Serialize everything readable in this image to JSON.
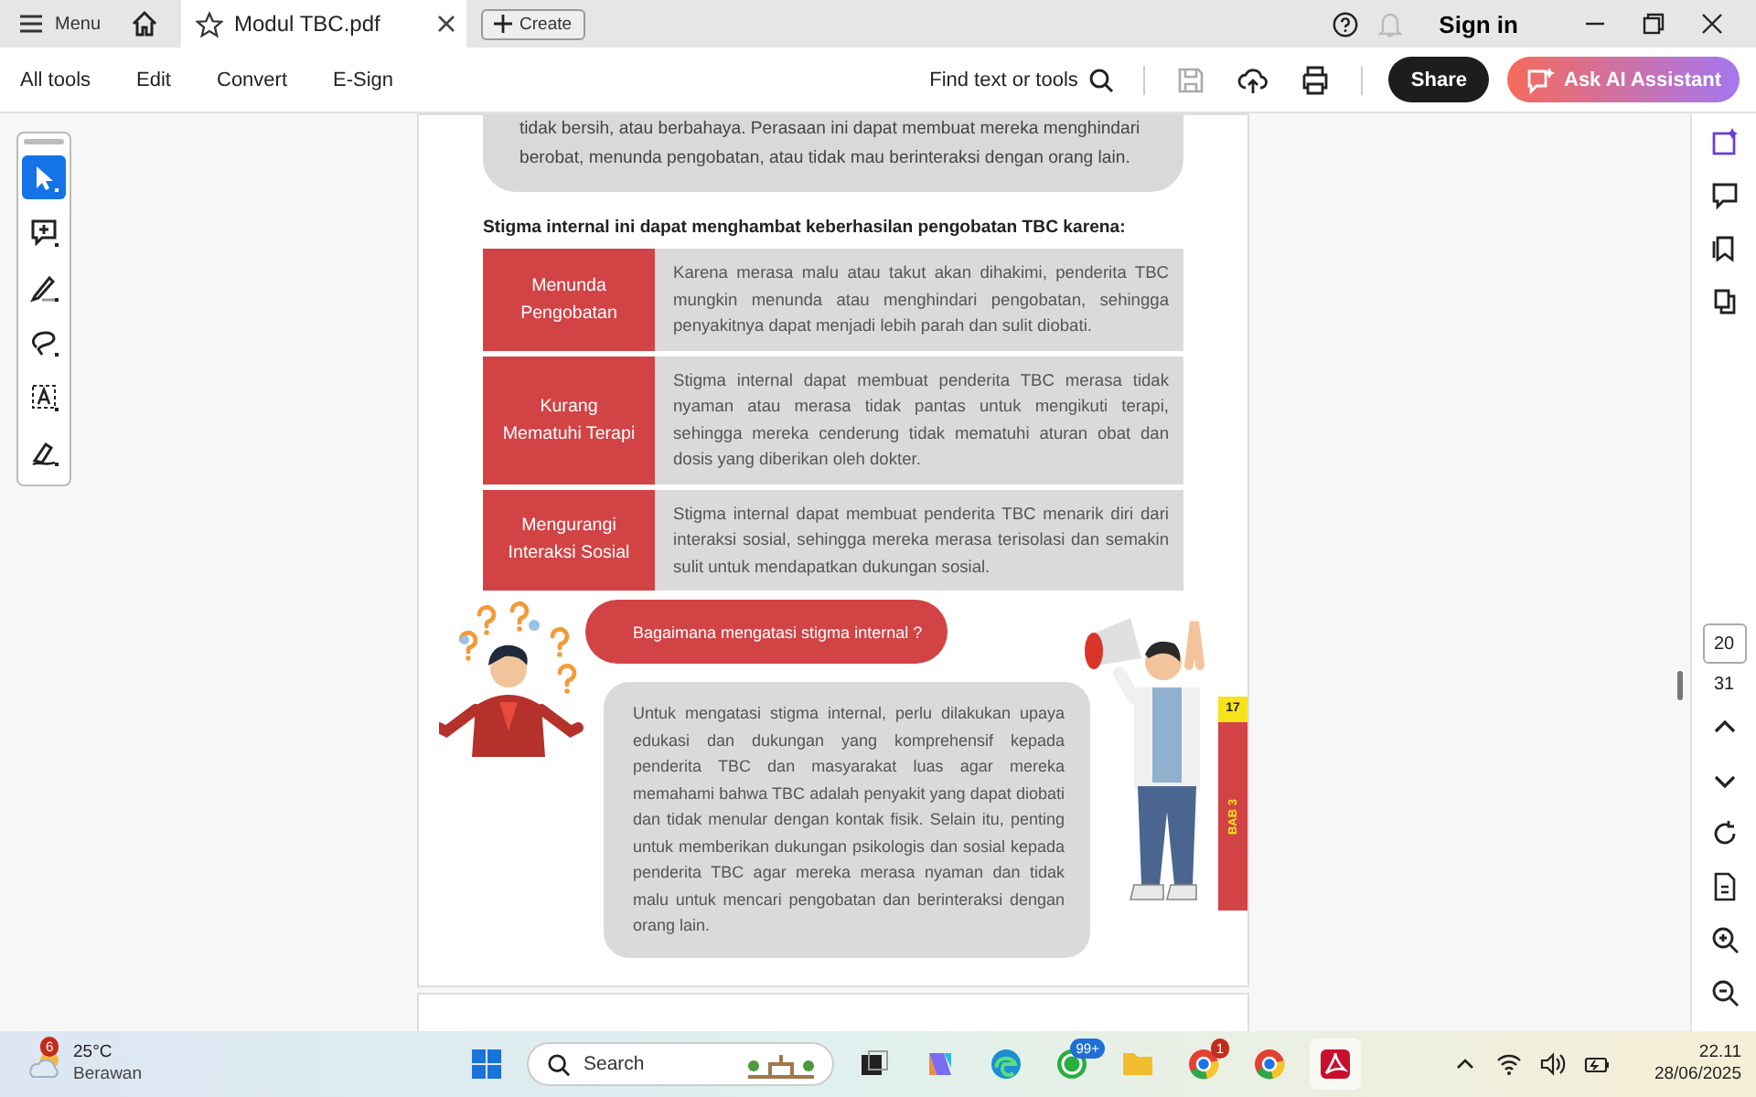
{
  "title_bar": {
    "menu": "Menu",
    "tab": {
      "title": "Modul TBC.pdf",
      "starred": false
    },
    "create": "Create",
    "sign_in": "Sign in"
  },
  "toolbar": {
    "menus": [
      "All tools",
      "Edit",
      "Convert",
      "E-Sign"
    ],
    "search": "Find text or tools",
    "share": "Share",
    "ai": "Ask AI Assistant"
  },
  "tools": [
    {
      "kind": "select",
      "selected": true
    },
    {
      "kind": "comment",
      "selected": false
    },
    {
      "kind": "draw",
      "selected": false
    },
    {
      "kind": "lasso",
      "selected": false
    },
    {
      "kind": "text-select",
      "selected": false
    },
    {
      "kind": "sign",
      "selected": false
    }
  ],
  "document": {
    "intro_lines": [
      "tidak bersih, atau berbahaya. Perasaan ini dapat membuat mereka menghindari",
      "berobat, menunda pengobatan, atau tidak mau berinteraksi dengan orang lain."
    ],
    "heading": "Stigma internal ini dapat menghambat keberhasilan pengobatan TBC karena:",
    "table": {
      "rows": [
        {
          "term_lines": [
            "Menunda",
            "Pengobatan"
          ],
          "description": "Karena merasa malu atau takut akan dihakimi, penderita TBC mungkin menunda atau menghindari pengobatan, sehingga penyakitnya dapat menjadi lebih parah dan sulit diobati."
        },
        {
          "term_lines": [
            "Kurang",
            "Mematuhi Terapi"
          ],
          "description": "Stigma internal dapat membuat penderita TBC merasa tidak nyaman atau merasa tidak pantas untuk mengikuti terapi, sehingga mereka cenderung tidak mematuhi aturan obat dan dosis yang diberikan oleh dokter."
        },
        {
          "term_lines": [
            "Mengurangi",
            "Interaksi Sosial"
          ],
          "description": "Stigma internal dapat membuat penderita TBC menarik diri dari interaksi sosial, sehingga mereka merasa terisolasi dan semakin sulit untuk mendapatkan dukungan sosial."
        }
      ]
    },
    "question": "Bagaimana mengatasi stigma internal ?",
    "answer": "Untuk mengatasi stigma internal, perlu dilakukan upaya edukasi dan dukungan yang komprehensif kepada penderita TBC dan masyarakat luas agar mereka memahami bahwa TBC adalah penyakit yang dapat diobati dan tidak menular dengan kontak fisik. Selain itu, penting untuk memberikan dukungan psikologis dan sosial kepada penderita TBC agar mereka merasa nyaman dan tidak malu untuk mencari pengobatan dan berinteraksi dengan orang lain.",
    "page_number": "17",
    "chapter": "BAB 3"
  },
  "page_nav": {
    "current": "20",
    "total": "31"
  },
  "taskbar": {
    "weather": {
      "temperature": "25°C",
      "condition": "Berawan",
      "badge": "6"
    },
    "search": "Search",
    "whatsapp_badge": "99+",
    "chrome_badge": "1",
    "time": "22.11",
    "date": "28/06/2025"
  }
}
